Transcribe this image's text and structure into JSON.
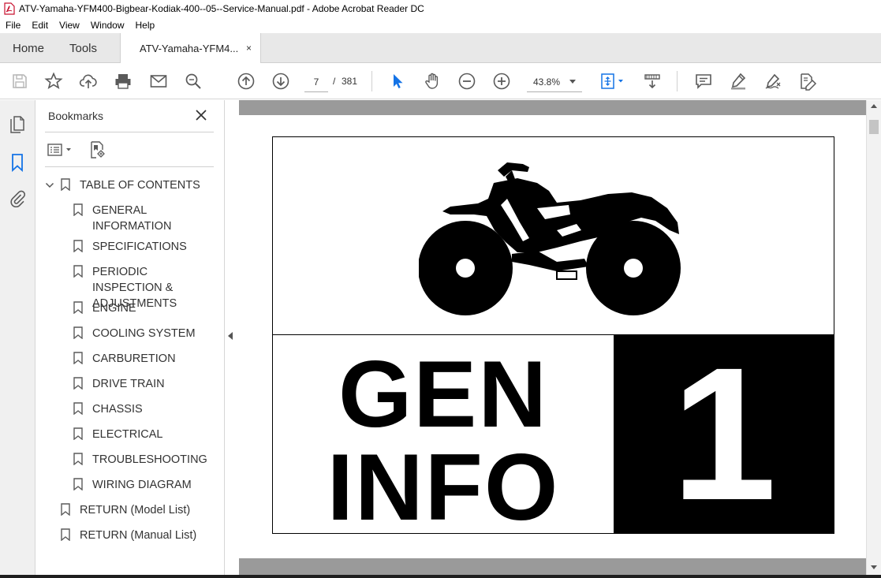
{
  "window": {
    "title": "ATV-Yamaha-YFM400-Bigbear-Kodiak-400--05--Service-Manual.pdf - Adobe Acrobat Reader DC"
  },
  "menu": [
    "File",
    "Edit",
    "View",
    "Window",
    "Help"
  ],
  "tabs": {
    "home": "Home",
    "tools": "Tools",
    "document": "ATV-Yamaha-YFM4...",
    "close_glyph": "×"
  },
  "toolbar": {
    "current_page": "7",
    "page_separator": "/",
    "total_pages": "381",
    "zoom": "43.8%"
  },
  "bookmarks": {
    "title": "Bookmarks",
    "root": "TABLE OF CONTENTS",
    "children": [
      "GENERAL INFORMATION",
      "SPECIFICATIONS",
      "PERIODIC INSPECTION & ADJUSTMENTS",
      "ENGINE",
      "COOLING SYSTEM",
      "CARBURETION",
      "DRIVE TRAIN",
      "CHASSIS",
      "ELECTRICAL",
      "TROUBLESHOOTING",
      "WIRING DIAGRAM"
    ],
    "return_model": "RETURN (Model List)",
    "return_manual": "RETURN (Manual List)"
  },
  "page_content": {
    "line1": "GEN",
    "line2": "INFO",
    "chapter_number": "1"
  },
  "colors": {
    "selected_blue": "#1473e6",
    "icon_gray": "#5a5a5a"
  }
}
